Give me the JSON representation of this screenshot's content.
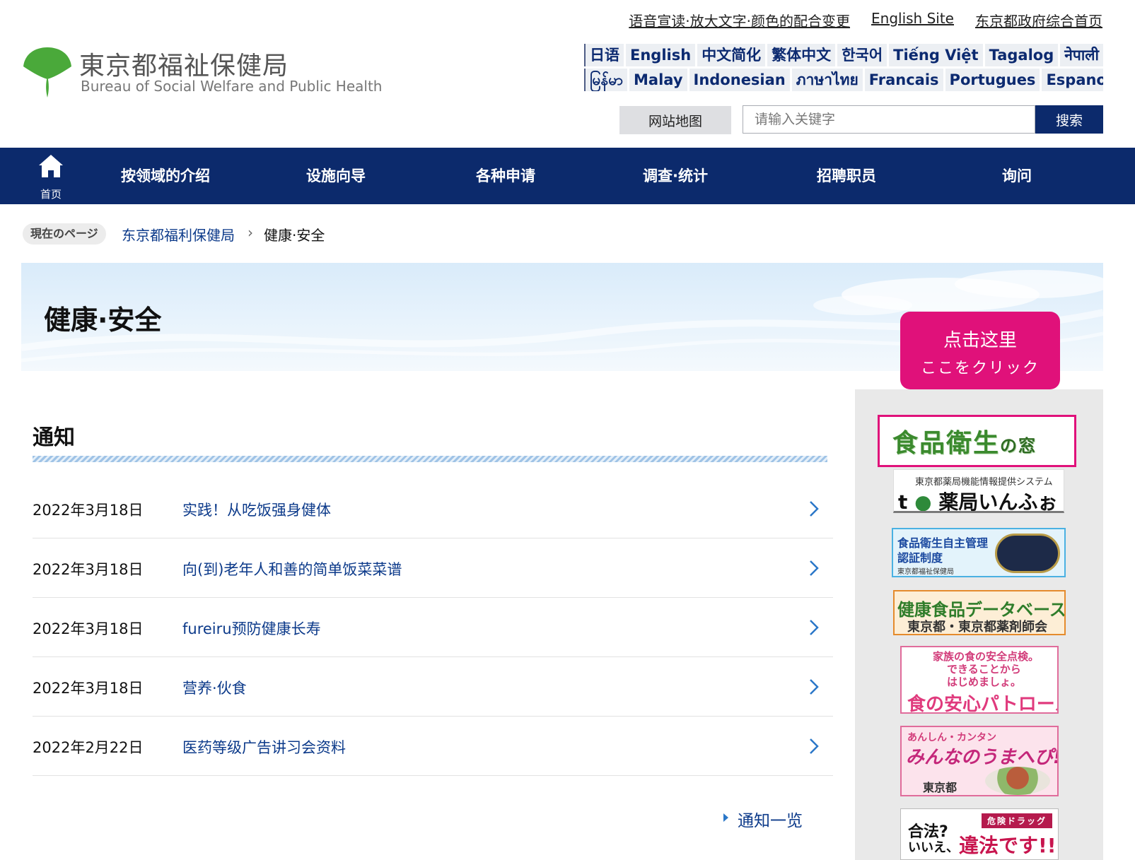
{
  "header": {
    "logo_ja": "東京都福祉保健局",
    "logo_en": "Bureau of Social Welfare and Public Health",
    "top_links": [
      "语音宣读·放大文字·颜色的配合变更",
      "English Site",
      "东京都政府综合首页"
    ],
    "languages_row1": [
      "日语",
      "English",
      "中文简化",
      "繁体中文",
      "한국어",
      "Tiếng Việt",
      "Tagalog",
      "नेपाली"
    ],
    "languages_row2": [
      "မြန်မာ",
      "Malay",
      "Indonesian",
      "ภาษาไทย",
      "Francais",
      "Portugues",
      "Espanol"
    ],
    "sitemap_label": "网站地图",
    "search_placeholder": "请输入关键字",
    "search_button": "搜索"
  },
  "nav": {
    "home_label": "首页",
    "items": [
      "按领域的介绍",
      "设施向导",
      "各种申请",
      "调查·统计",
      "招聘职员",
      "询问"
    ]
  },
  "breadcrumb": {
    "label": "現在のページ",
    "link": "东京都福利保健局",
    "current": "健康·安全"
  },
  "banner": {
    "title": "健康·安全"
  },
  "callout": {
    "zh": "点击这里",
    "ja": "ここをクリック"
  },
  "news": {
    "title": "通知",
    "items": [
      {
        "date": "2022年3月18日",
        "title": "实践！从吃饭强身健体"
      },
      {
        "date": "2022年3月18日",
        "title": "向(到)老年人和善的简单饭菜菜谱"
      },
      {
        "date": "2022年3月18日",
        "title": "fureiru预防健康长寿"
      },
      {
        "date": "2022年3月18日",
        "title": "营养·伙食"
      },
      {
        "date": "2022年2月22日",
        "title": "医药等级广告讲习会资料"
      }
    ],
    "more": "通知一览"
  },
  "sidebar": {
    "food_hygiene": {
      "main": "食品衛生",
      "suffix": "の窓"
    },
    "yakkyoku": {
      "sub": "東京都薬局機能情報提供システム",
      "main_prefix": "t",
      "main": "薬局いんふぉ"
    },
    "cert": {
      "line1": "食品衛生自主管理",
      "line2": "認証制度",
      "line3": "東京都福祉保健局"
    },
    "health_food_db": {
      "line1": "健康食品データベース",
      "line2": "東京都・東京都薬剤師会"
    },
    "patrol": {
      "line1": "家族の食の安全点検。",
      "line2": "できることから",
      "line3": "はじめましょ。",
      "line4": "食の安心パトロール"
    },
    "minna": {
      "line1": "あんしん・カンタン",
      "line2": "みんなのうまへぴ!",
      "line3": "東京都"
    },
    "drug": {
      "tag": "危険ドラッグ",
      "line1": "合法?",
      "line2": "いいえ、",
      "line3": "違法です!!"
    }
  },
  "colors": {
    "nav_bg": "#0c2a6c",
    "link": "#0c3a8a",
    "callout": "#e0117a",
    "logo_green": "#4aa93a"
  }
}
